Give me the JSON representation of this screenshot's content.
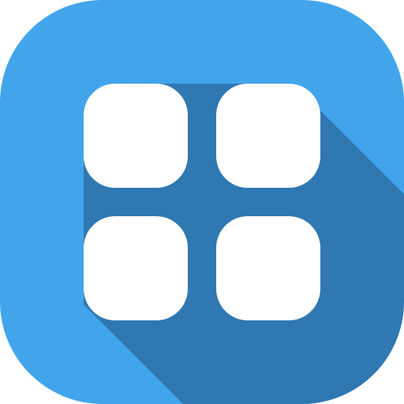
{
  "icon": {
    "name": "app-grid-icon",
    "colors": {
      "background": "#42a5ec",
      "shadow": "#3078b1",
      "tiles": "#ffffff"
    },
    "tiles": [
      "top-left",
      "top-right",
      "bottom-left",
      "bottom-right"
    ]
  }
}
